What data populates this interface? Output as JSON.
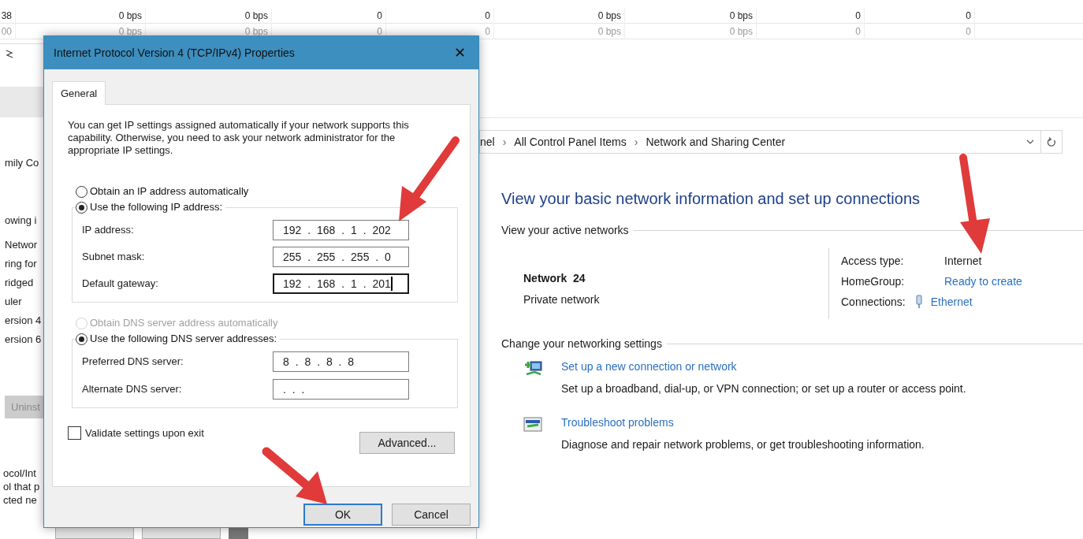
{
  "background_table": {
    "rows": [
      {
        "cells": [
          "38",
          "0 bps",
          "0 bps",
          "0",
          "0",
          "0 bps",
          "0 bps",
          "0",
          "0"
        ]
      },
      {
        "cells": [
          "00",
          "0 bps",
          "0 bps",
          "0",
          "0",
          "0 bps",
          "0 bps",
          "0",
          "0"
        ]
      }
    ]
  },
  "background_window": {
    "header_label": "mily Co",
    "list_header": "owing i",
    "list_items": [
      "Networ",
      "ring for",
      "ridged",
      "uler",
      "ersion 4",
      "ersion 6"
    ],
    "uninstall_button": {
      "label": "Uninst",
      "disabled": true
    },
    "description_lines": [
      "ocol/Int",
      "ol that p",
      "cted ne"
    ]
  },
  "control_panel": {
    "separator": "›",
    "breadcrumb": [
      "nel",
      "All Control Panel Items",
      "Network and Sharing Center"
    ],
    "heading": "View your basic network information and set up connections",
    "active_networks_label": "View your active networks",
    "network": {
      "name": "Network  24",
      "type": "Private network"
    },
    "details": [
      {
        "label": "Access type:",
        "value": "Internet",
        "kind": "text"
      },
      {
        "label": "HomeGroup:",
        "value": "Ready to create",
        "kind": "link"
      },
      {
        "label": "Connections:",
        "value": "Ethernet",
        "kind": "connection"
      }
    ],
    "settings_label": "Change your networking settings",
    "tasks": [
      {
        "kind": "new_connection",
        "title": "Set up a new connection or network",
        "description": "Set up a broadband, dial-up, or VPN connection; or set up a router or access point."
      },
      {
        "kind": "troubleshoot",
        "title": "Troubleshoot problems",
        "description": "Diagnose and repair network problems, or get troubleshooting information."
      }
    ]
  },
  "dialog": {
    "title": "Internet Protocol Version 4 (TCP/IPv4) Properties",
    "close": "✕",
    "tabs": [
      {
        "label": "General",
        "selected": true
      }
    ],
    "description": "You can get IP settings assigned automatically if your network supports this capability. Otherwise, you need to ask your network administrator for the appropriate IP settings.",
    "ip_options": [
      {
        "label": "Obtain an IP address automatically",
        "selected": false,
        "disabled": false
      },
      {
        "label": "Use the following IP address:",
        "selected": true,
        "disabled": false
      }
    ],
    "ip_fields": [
      {
        "label": "IP address:",
        "value": "192 . 168 . 1 . 202",
        "focused": false
      },
      {
        "label": "Subnet mask:",
        "value": "255 . 255 . 255 . 0",
        "focused": false
      },
      {
        "label": "Default gateway:",
        "value": "192 . 168 . 1 . 201",
        "focused": true
      }
    ],
    "dns_options": [
      {
        "label": "Obtain DNS server address automatically",
        "selected": false,
        "disabled": true
      },
      {
        "label": "Use the following DNS server addresses:",
        "selected": true,
        "disabled": false
      }
    ],
    "dns_fields": [
      {
        "label": "Preferred DNS server:",
        "value": "8 . 8 . 8 . 8",
        "focused": false
      },
      {
        "label": "Alternate DNS server:",
        "value": ". . .",
        "focused": false
      }
    ],
    "validate": {
      "label": "Validate settings upon exit",
      "checked": false
    },
    "advanced_button": "Advanced...",
    "buttons": [
      {
        "label": "OK",
        "focused": true
      },
      {
        "label": "Cancel",
        "focused": false
      }
    ]
  }
}
